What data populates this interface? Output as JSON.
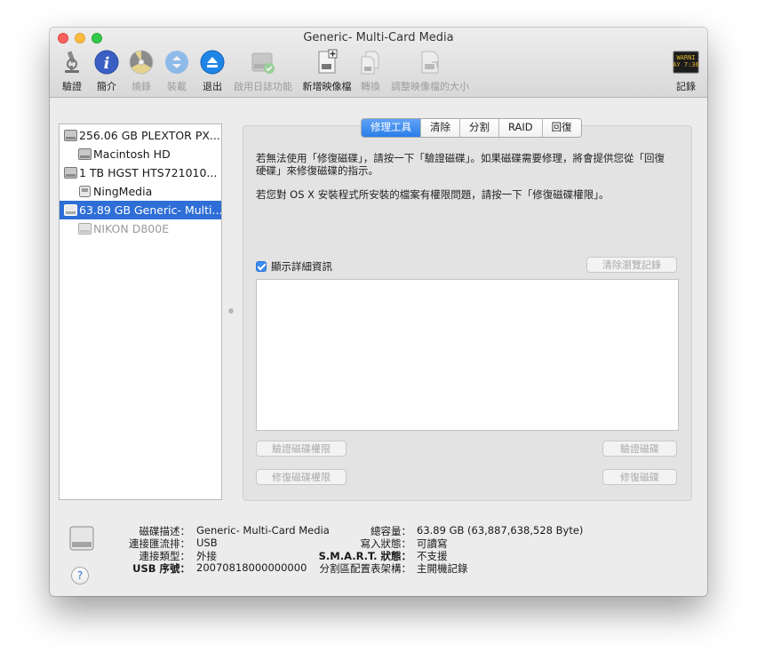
{
  "window": {
    "title": "Generic- Multi-Card Media"
  },
  "toolbar": {
    "items": [
      {
        "icon": "microscope-icon",
        "label": "驗證"
      },
      {
        "icon": "info-icon",
        "label": "簡介"
      },
      {
        "icon": "burn-icon",
        "label": "燒錄"
      },
      {
        "icon": "mount-icon",
        "label": "裝載"
      },
      {
        "icon": "eject-icon",
        "label": "退出"
      },
      {
        "icon": "log-disk-icon",
        "label": "啟用日誌功能"
      },
      {
        "icon": "new-image-icon",
        "label": "新增映像檔"
      },
      {
        "icon": "convert-icon",
        "label": "轉換"
      },
      {
        "icon": "resize-image-icon",
        "label": "調整映像檔的大小"
      }
    ],
    "log": {
      "icon": "console-log-icon",
      "label": "記錄",
      "icon_text": "WARNI\nAY 7:36"
    }
  },
  "sidebar": {
    "items": [
      {
        "label": "256.06 GB PLEXTOR PX...",
        "level": 0
      },
      {
        "label": "Macintosh HD",
        "level": 1
      },
      {
        "label": "1 TB HGST HTS721010...",
        "level": 0
      },
      {
        "label": "NingMedia",
        "level": 1
      },
      {
        "label": "63.89 GB Generic- Multi...",
        "level": 0,
        "selected": true
      },
      {
        "label": "NIKON D800E",
        "level": 1,
        "dim": true
      }
    ]
  },
  "tabs": [
    "修理工具",
    "清除",
    "分割",
    "RAID",
    "回復"
  ],
  "first_aid": {
    "desc1": "若無法使用「修復磁碟」，請按一下「驗證磁碟」。如果磁碟需要修理，將會提供您從「回復硬碟」來修復磁碟的指示。",
    "desc2": "若您對 OS X 安裝程式所安裝的檔案有權限問題，請按一下「修復磁碟權限」。",
    "show_details": "顯示詳細資訊",
    "clear_history": "清除瀏覽記錄",
    "verify_permissions": "驗證磁碟權限",
    "verify_disk": "驗證磁碟",
    "repair_permissions": "修復磁碟權限",
    "repair_disk": "修復磁碟"
  },
  "info": {
    "left": [
      {
        "k": "磁碟描述：",
        "v": "Generic- Multi-Card Media"
      },
      {
        "k": "連接匯流排：",
        "v": "USB"
      },
      {
        "k": "連接類型：",
        "v": "外接"
      },
      {
        "k": "USB 序號：",
        "v": "20070818000000000"
      }
    ],
    "right": [
      {
        "k": "總容量：",
        "v": "63.89 GB (63,887,638,528 Byte)"
      },
      {
        "k": "寫入狀態：",
        "v": "可讀寫"
      },
      {
        "k": "S.M.A.R.T. 狀態：",
        "v": "不支援"
      },
      {
        "k": "分割區配置表架構：",
        "v": "主開機記錄"
      }
    ],
    "help": "?"
  }
}
